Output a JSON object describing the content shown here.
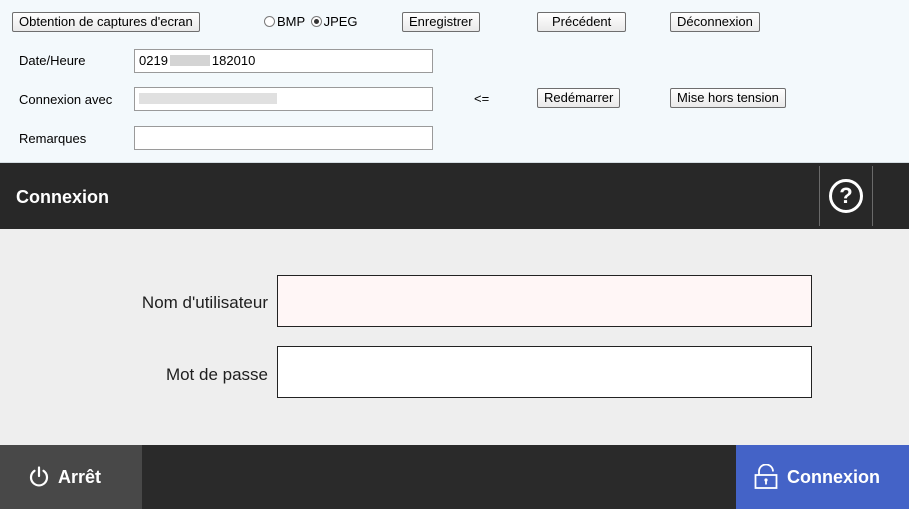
{
  "toolbar": {
    "capture_button": "Obtention de captures d'ecran",
    "format_bmp": "BMP",
    "format_jpeg": "JPEG",
    "format_selected": "JPEG",
    "save_button": "Enregistrer",
    "previous_button": "Précédent",
    "logout_button": "Déconnexion",
    "datetime_label": "Date/Heure",
    "datetime_prefix": "0219",
    "datetime_suffix": "182010",
    "connection_label": "Connexion avec",
    "arrow": "<=",
    "restart_button": "Redémarrer",
    "poweroff_button": "Mise hors tension",
    "remarks_label": "Remarques",
    "remarks_value": ""
  },
  "header": {
    "title": "Connexion",
    "help_icon": "help-circle-icon",
    "help_glyph": "?"
  },
  "form": {
    "username_label": "Nom d'utilisateur",
    "username_value": "",
    "password_label": "Mot de passe",
    "password_value": ""
  },
  "footer": {
    "stop_label": "Arrêt",
    "stop_icon": "power-icon",
    "login_label": "Connexion",
    "login_icon": "unlock-icon"
  },
  "colors": {
    "toolbar_bg": "#f3f9fc",
    "header_bg": "#282828",
    "form_bg": "#eeeeee",
    "footer_bg": "#2a2a2a",
    "stop_bg": "#484848",
    "login_accent": "#4463c7"
  }
}
